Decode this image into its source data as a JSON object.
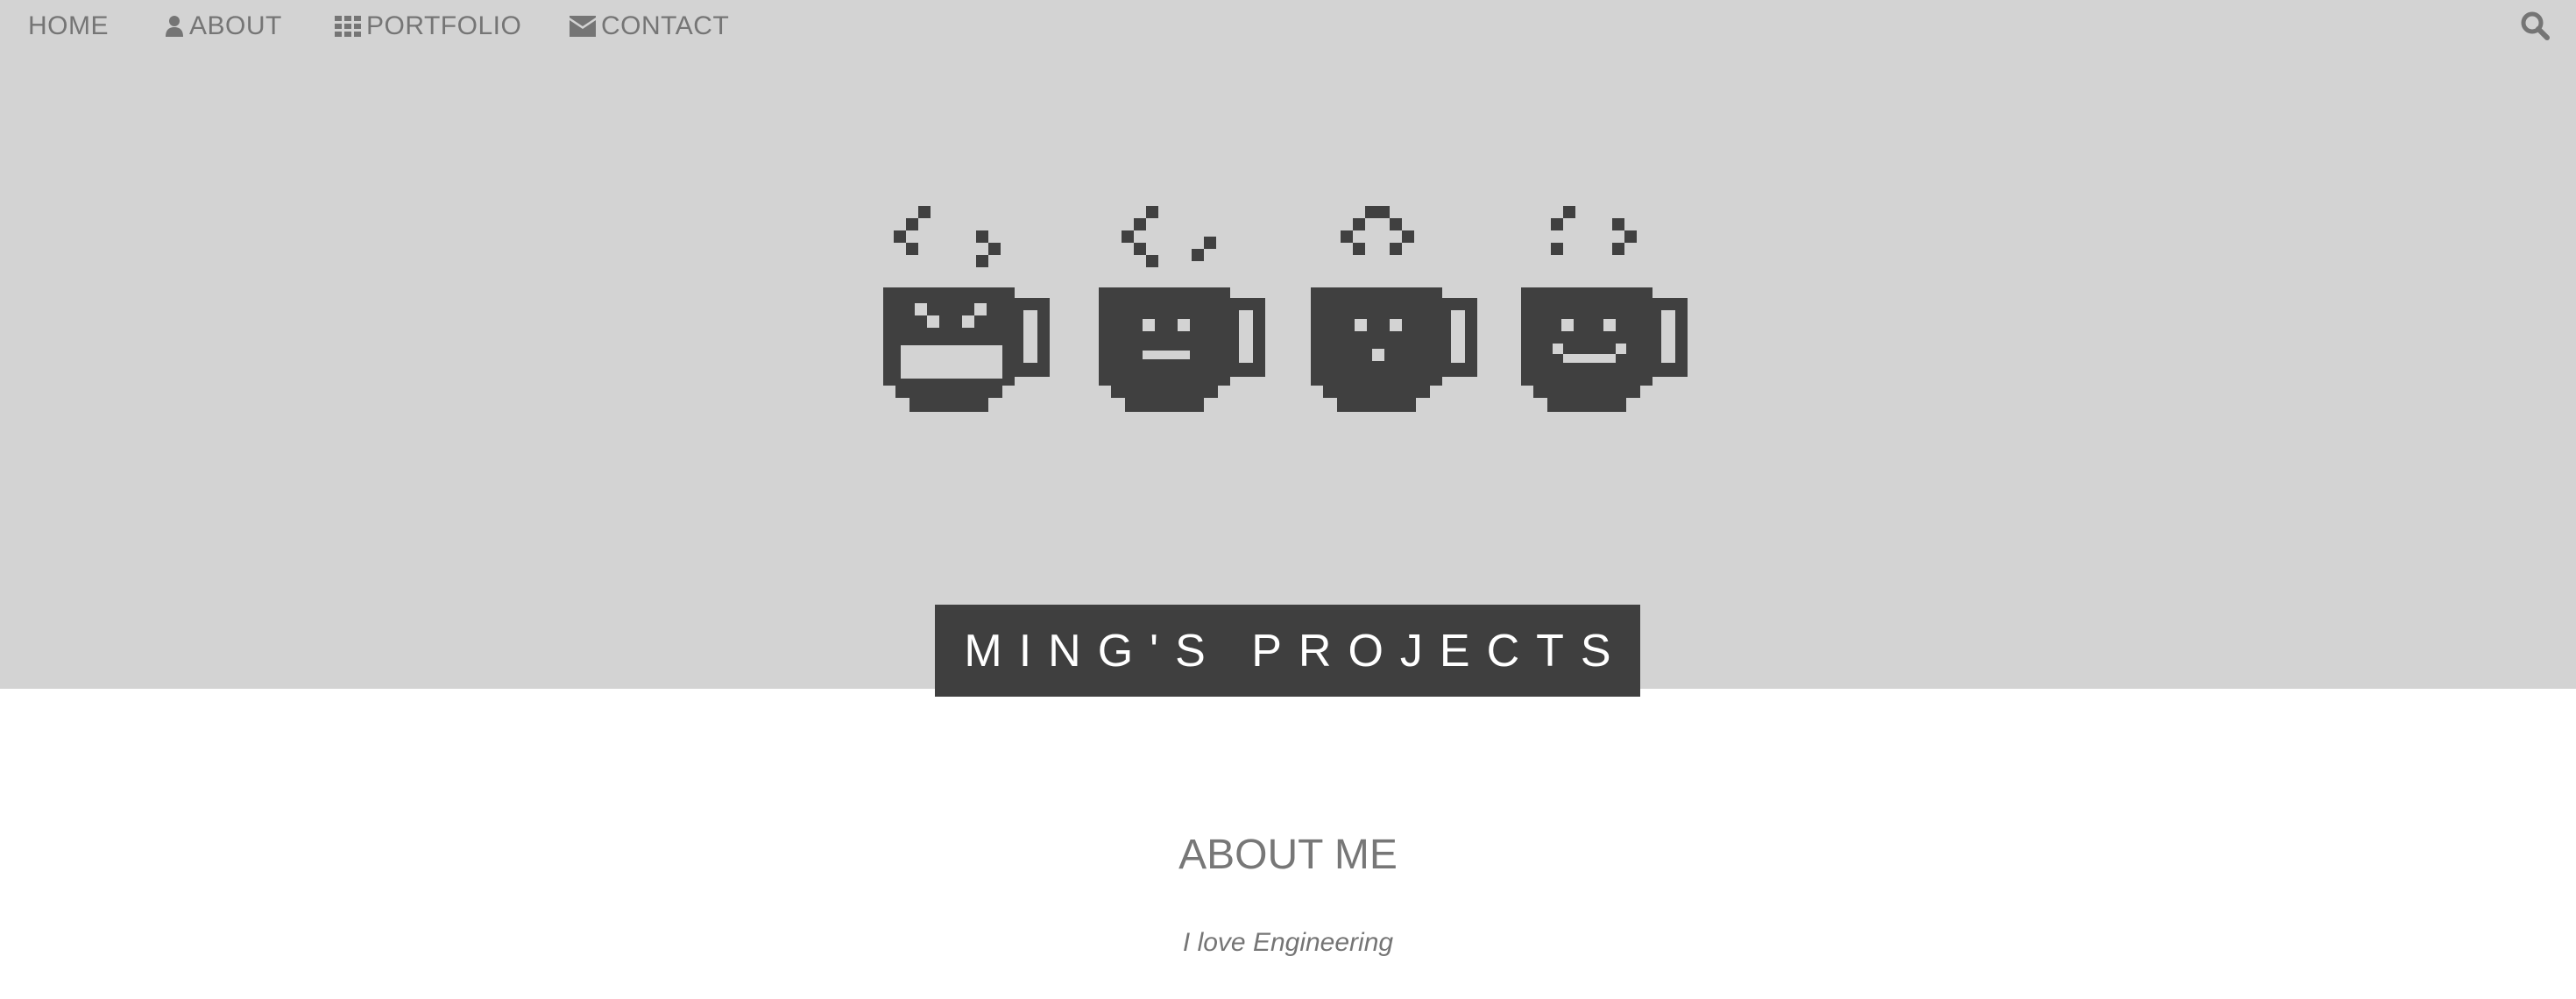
{
  "nav": {
    "items": [
      {
        "label": "HOME",
        "icon": ""
      },
      {
        "label": "ABOUT",
        "icon": "user-icon"
      },
      {
        "label": "PORTFOLIO",
        "icon": "grid-icon"
      },
      {
        "label": "CONTACT",
        "icon": "envelope-icon"
      }
    ],
    "search_icon": "search-icon"
  },
  "hero": {
    "background": "#d3d3d3",
    "title": "MING'S PROJECTS",
    "title_bg": "#3f3f3f",
    "graphic": "four pixel coffee mugs"
  },
  "about": {
    "heading": "ABOUT ME",
    "tagline": "I love Engineering"
  }
}
